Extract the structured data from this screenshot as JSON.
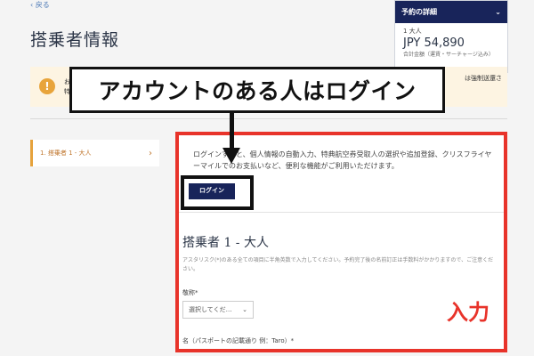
{
  "nav": {
    "back": "‹ 戻る"
  },
  "page": {
    "title": "搭乗者情報"
  },
  "booking": {
    "header": "予約の詳細",
    "pax": "1 大人",
    "price": "JPY 54,890",
    "note": "合計金額（運賃・サーチャージ込み）"
  },
  "alert": {
    "left_line1": "お",
    "left_line2": "特",
    "right_line1": "は強制送還さ",
    "right_line2": ""
  },
  "side": {
    "step_label": "1. 搭乗者 1 - 大人"
  },
  "form": {
    "login_text": "ログインすると、個人情報の自動入力、特典航空券受取人の選択や追加登録、クリスフライヤーマイルでのお支払いなど、便利な機能がご利用いただけます。",
    "login_button": "ログイン",
    "pax_title": "搭乗者 1 - 大人",
    "asterisk_note": "アスタリスク(*)のある全ての項目に半角英数で入力してください。予約完了後の名前訂正は手数料がかかりますので、ご注意ください。",
    "title_label": "敬称*",
    "title_select": "選択してくだ…",
    "first_name_label": "名（パスポートの記載通り 例：Taro）*"
  },
  "annotations": {
    "callout": "アカウントのある人はログイン",
    "input_tag": "入力"
  },
  "colors": {
    "accent_red": "#e8332a",
    "navy": "#18245a",
    "orange": "#e6a23c"
  }
}
